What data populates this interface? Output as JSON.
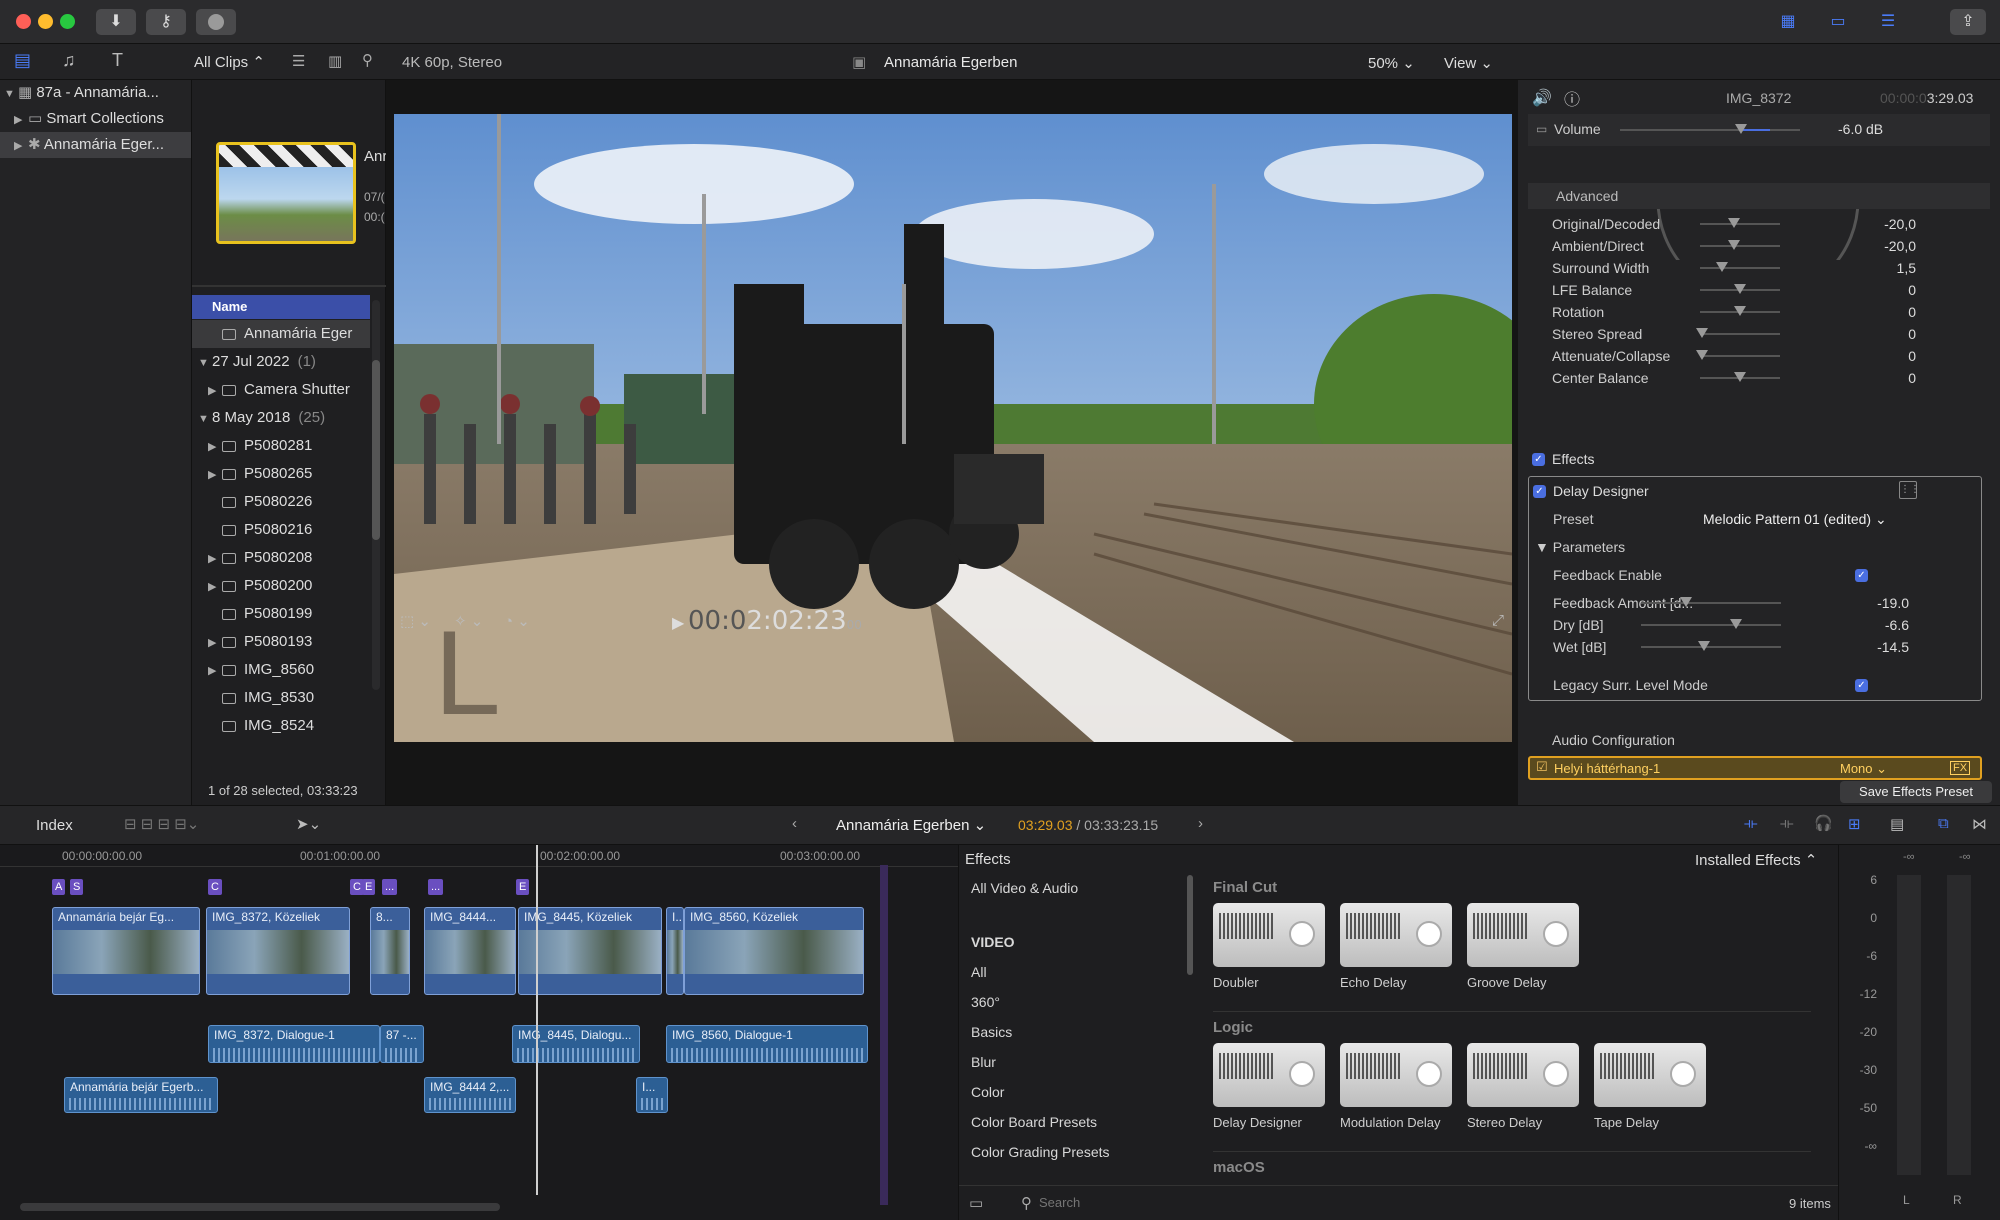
{
  "toolbar": {
    "all_clips": "All Clips",
    "format": "4K 60p, Stereo",
    "project_title": "Annamária Egerben",
    "zoom": "50%",
    "view": "View"
  },
  "library": {
    "items": [
      {
        "label": "87a - Annamária..."
      },
      {
        "label": "Smart Collections"
      },
      {
        "label": "Annamária Eger..."
      }
    ]
  },
  "browser": {
    "thumb_title": "Anr",
    "thumb_meta1": "07/(",
    "thumb_meta2": "00:(",
    "column_name": "Name",
    "rows": [
      {
        "label": "Annamária Eger",
        "type": "project",
        "indent": 1,
        "selected": true
      },
      {
        "label": "27 Jul 2022",
        "count": "(1)",
        "type": "group",
        "indent": 0
      },
      {
        "label": "Camera Shutter",
        "type": "audio",
        "indent": 1,
        "expand": true
      },
      {
        "label": "8 May 2018",
        "count": "(25)",
        "type": "group",
        "indent": 0
      },
      {
        "label": "P5080281",
        "type": "clip",
        "indent": 1,
        "expand": true
      },
      {
        "label": "P5080265",
        "type": "clip",
        "indent": 1,
        "expand": true
      },
      {
        "label": "P5080226",
        "type": "clip",
        "indent": 1,
        "expand": false
      },
      {
        "label": "P5080216",
        "type": "clip",
        "indent": 1,
        "expand": false
      },
      {
        "label": "P5080208",
        "type": "clip",
        "indent": 1,
        "expand": true
      },
      {
        "label": "P5080200",
        "type": "clip",
        "indent": 1,
        "expand": true
      },
      {
        "label": "P5080199",
        "type": "clip",
        "indent": 1,
        "expand": false
      },
      {
        "label": "P5080193",
        "type": "clip",
        "indent": 1,
        "expand": true
      },
      {
        "label": "IMG_8560",
        "type": "clip",
        "indent": 1,
        "expand": true
      },
      {
        "label": "IMG_8530",
        "type": "clip",
        "indent": 1,
        "expand": false
      },
      {
        "label": "IMG_8524",
        "type": "clip",
        "indent": 1,
        "expand": false
      }
    ],
    "status": "1 of 28 selected, 03:33:23"
  },
  "viewer": {
    "timecode_dim": "00:0",
    "timecode": "2:02:23",
    "timecode_frames": "00"
  },
  "inspector": {
    "clip_name": "IMG_8372",
    "duration_dim": "00:00:0",
    "duration": "3:29.03",
    "volume_label": "Volume",
    "volume_value": "-6.0",
    "volume_unit": "dB",
    "advanced_label": "Advanced",
    "advanced_params": [
      {
        "label": "Original/Decoded",
        "value": "-20,0",
        "pos": 0.42
      },
      {
        "label": "Ambient/Direct",
        "value": "-20,0",
        "pos": 0.42
      },
      {
        "label": "Surround Width",
        "value": "1,5",
        "pos": 0.27
      },
      {
        "label": "LFE Balance",
        "value": "0",
        "pos": 0.5
      },
      {
        "label": "Rotation",
        "value": "0",
        "pos": 0.5
      },
      {
        "label": "Stereo Spread",
        "value": "0",
        "pos": 0.03
      },
      {
        "label": "Attenuate/Collapse",
        "value": "0",
        "pos": 0.03
      },
      {
        "label": "Center Balance",
        "value": "0",
        "pos": 0.5
      }
    ],
    "effects_label": "Effects",
    "delay_designer": "Delay Designer",
    "preset_label": "Preset",
    "preset_value": "Melodic Pattern 01 (edited)",
    "parameters_label": "Parameters",
    "feedback_enable": "Feedback Enable",
    "dd_params": [
      {
        "label": "Feedback Amount [d...",
        "value": "-19.0",
        "pos": 0.32
      },
      {
        "label": "Dry [dB]",
        "value": "-6.6",
        "pos": 0.68
      },
      {
        "label": "Wet [dB]",
        "value": "-14.5",
        "pos": 0.45
      }
    ],
    "legacy_mode": "Legacy Surr. Level Mode",
    "audio_config": "Audio Configuration",
    "role_name": "Helyi háttérhang-1",
    "role_mode": "Mono",
    "role_fx": "FX",
    "save_preset": "Save Effects Preset"
  },
  "timeline_bar": {
    "index": "Index",
    "project": "Annamária Egerben",
    "tc_position": "03:29.03",
    "tc_total": "03:33:23.15"
  },
  "timeline": {
    "ruler": [
      "00:00:00:00.00",
      "00:00:01:00:00.00",
      "00:00:02:00:00.00",
      "00:00:03:00:00.00"
    ],
    "ruler_labels": [
      "00:00:00:00.00",
      "00:01:00:00.00",
      "00:02:00:00.00",
      "00:03:00:00.00"
    ],
    "video_clips": [
      {
        "label": "Annamária bejár Eg...",
        "x": 0
      },
      {
        "label": "IMG_8372, Közeliek",
        "x": 1
      },
      {
        "label": "8...",
        "x": 2
      },
      {
        "label": "IMG_8444...",
        "x": 3
      },
      {
        "label": "IMG_8445, Közeliek",
        "x": 4
      },
      {
        "label": "I...",
        "x": 5
      },
      {
        "label": "IMG_8560, Közeliek",
        "x": 6
      }
    ],
    "dialogue_clips": [
      "IMG_8372, Dialogue-1",
      "87 -...",
      "IMG_8445, Dialogu...",
      "IMG_8560, Dialogue-1"
    ],
    "audio_clips": [
      "Annamária bejár Egerb...",
      "IMG_8444 2,...",
      "I..."
    ],
    "markers": [
      "A",
      "S",
      "C",
      "C",
      "E",
      "...",
      "...",
      "E"
    ]
  },
  "effects_browser": {
    "title": "Effects",
    "installed": "Installed Effects",
    "categories": [
      "All Video & Audio",
      "VIDEO",
      "All",
      "360°",
      "Basics",
      "Blur",
      "Color",
      "Color Board Presets",
      "Color Grading Presets"
    ],
    "groups": [
      {
        "name": "Final Cut",
        "items": [
          "Doubler",
          "Echo Delay",
          "Groove Delay"
        ]
      },
      {
        "name": "Logic",
        "items": [
          "Delay Designer",
          "Modulation Delay",
          "Stereo Delay",
          "Tape Delay"
        ]
      },
      {
        "name": "macOS",
        "items": []
      }
    ],
    "search_placeholder": "Search",
    "count": "9 items"
  },
  "meters": {
    "top_left": "-∞",
    "top_right": "-∞",
    "scale": [
      "6",
      "0",
      "-6",
      "-12",
      "-20",
      "-30",
      "-50",
      "-∞"
    ],
    "left": "L",
    "right": "R"
  }
}
